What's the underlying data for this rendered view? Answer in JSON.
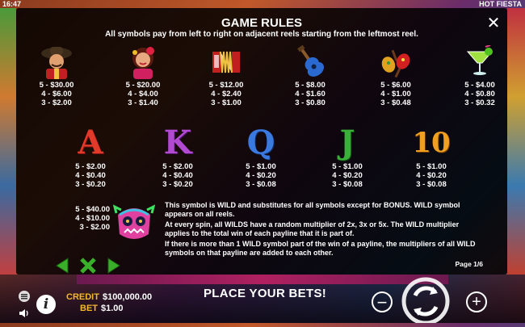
{
  "status": {
    "time": "16:47",
    "game_title": "HOT FIESTA"
  },
  "rules": {
    "title": "GAME RULES",
    "subtitle": "All symbols pay from left to right on adjacent reels starting from the leftmost reel.",
    "high_symbols": [
      {
        "icon": "mariachi-icon",
        "pays": [
          "5 - $30.00",
          "4 - $6.00",
          "3 - $2.00"
        ]
      },
      {
        "icon": "senorita-icon",
        "pays": [
          "5 - $20.00",
          "4 - $4.00",
          "3 - $1.40"
        ]
      },
      {
        "icon": "accordion-icon",
        "pays": [
          "5 - $12.00",
          "4 - $2.40",
          "3 - $1.00"
        ]
      },
      {
        "icon": "guitar-icon",
        "pays": [
          "5 - $8.00",
          "4 - $1.60",
          "3 - $0.80"
        ]
      },
      {
        "icon": "maracas-icon",
        "pays": [
          "5 - $6.00",
          "4 - $1.00",
          "3 - $0.48"
        ]
      },
      {
        "icon": "margarita-icon",
        "pays": [
          "5 - $4.00",
          "4 - $0.80",
          "3 - $0.32"
        ]
      }
    ],
    "low_symbols": [
      {
        "letter": "A",
        "color": "#e23a2a",
        "pays": [
          "5 - $2.00",
          "4 - $0.40",
          "3 - $0.20"
        ]
      },
      {
        "letter": "K",
        "color": "#b04ad0",
        "pays": [
          "5 - $2.00",
          "4 - $0.40",
          "3 - $0.20"
        ]
      },
      {
        "letter": "Q",
        "color": "#3a7ae0",
        "pays": [
          "5 - $1.00",
          "4 - $0.20",
          "3 - $0.08"
        ]
      },
      {
        "letter": "J",
        "color": "#3ab03a",
        "pays": [
          "5 - $1.00",
          "4 - $0.20",
          "3 - $0.08"
        ]
      },
      {
        "letter": "10",
        "color": "#f0a020",
        "pays": [
          "5 - $1.00",
          "4 - $0.20",
          "3 - $0.08"
        ]
      }
    ],
    "wild": {
      "icon": "wild-skull-icon",
      "pays": [
        "5 - $40.00",
        "4 - $10.00",
        "3 - $2.00"
      ],
      "text": [
        "This symbol is WILD and substitutes for all symbols except for BONUS. WILD symbol appears on all reels.",
        "At every spin, all WILDS have a random multiplier of 2x, 3x or 5x. The WILD multiplier applies to the total win of each payline that it is part of.",
        "If there is more than 1 WILD symbol part of the win of a payline, the multipliers of all WILD symbols on that payline are added to each other."
      ]
    },
    "page": "Page 1/6"
  },
  "footer": {
    "credit_label": "CREDIT",
    "credit_value": "$100,000.00",
    "bet_label": "BET",
    "bet_value": "$1.00",
    "message": "PLACE YOUR BETS!",
    "accent": "#f5b82a"
  }
}
